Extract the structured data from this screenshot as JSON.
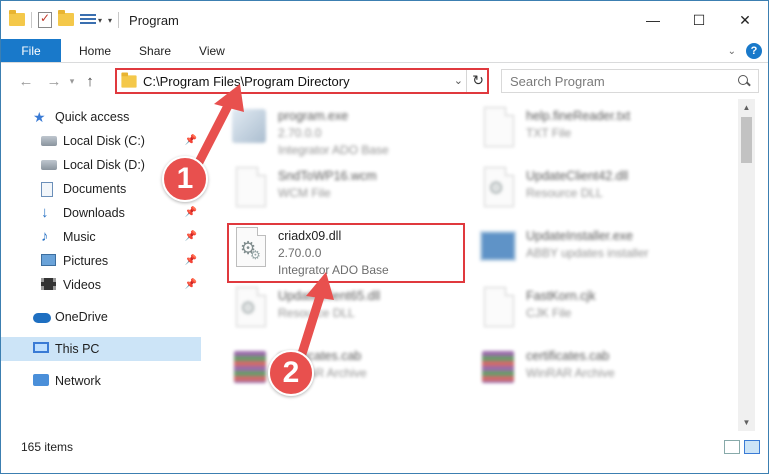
{
  "window": {
    "title": "Program",
    "controls": {
      "minimize": "—",
      "maximize": "☐",
      "close": "✕"
    }
  },
  "ribbon": {
    "tabs": [
      "File",
      "Home",
      "Share",
      "View"
    ]
  },
  "address": {
    "path": "C:\\Program Files\\Program Directory",
    "search_placeholder": "Search Program"
  },
  "sidebar": {
    "items": [
      {
        "label": "Quick access",
        "icon": "star-icon",
        "pinned": false
      },
      {
        "label": "Local Disk (C:)",
        "icon": "disk-icon",
        "pinned": true
      },
      {
        "label": "Local Disk (D:)",
        "icon": "disk-icon",
        "pinned": true
      },
      {
        "label": "Documents",
        "icon": "documents-icon",
        "pinned": true
      },
      {
        "label": "Downloads",
        "icon": "download-icon",
        "pinned": true
      },
      {
        "label": "Music",
        "icon": "music-icon",
        "pinned": true
      },
      {
        "label": "Pictures",
        "icon": "pictures-icon",
        "pinned": true
      },
      {
        "label": "Videos",
        "icon": "videos-icon",
        "pinned": true
      },
      {
        "label": "OneDrive",
        "icon": "onedrive-icon",
        "pinned": false
      },
      {
        "label": "This PC",
        "icon": "pc-icon",
        "pinned": false,
        "selected": true
      },
      {
        "label": "Network",
        "icon": "network-icon",
        "pinned": false
      }
    ]
  },
  "files": [
    {
      "name": "program.exe",
      "line2": "2.70.0.0",
      "line3": "Integrator ADO Base",
      "icon": "exe-icon",
      "blurred": true
    },
    {
      "name": "help.fineReader.txt",
      "line2": "TXT File",
      "line3": "",
      "icon": "text-file-icon",
      "blurred": true
    },
    {
      "name": "SndToWP16.wcm",
      "line2": "WCM File",
      "line3": "",
      "icon": "generic-file-icon",
      "blurred": true
    },
    {
      "name": "UpdateClient42.dll",
      "line2": "Resource DLL",
      "line3": "",
      "icon": "dll-icon",
      "blurred": true
    },
    {
      "name": "criadx09.dll",
      "line2": "2.70.0.0",
      "line3": "Integrator ADO Base",
      "icon": "dll-icon",
      "blurred": false
    },
    {
      "name": "UpdateInstaller.exe",
      "line2": "ABBY updates installer",
      "line3": "",
      "icon": "installer-icon",
      "blurred": true
    },
    {
      "name": "UpdateClient65.dll",
      "line2": "Resource DLL",
      "line3": "",
      "icon": "dll-icon",
      "blurred": true
    },
    {
      "name": "FastKorn.cjk",
      "line2": "CJK File",
      "line3": "",
      "icon": "generic-file-icon",
      "blurred": true
    },
    {
      "name": "certificates.cab",
      "line2": "WinRAR Archive",
      "line3": "",
      "icon": "winrar-icon",
      "blurred": true
    },
    {
      "name": "certificates.cab",
      "line2": "WinRAR Archive",
      "line3": "",
      "icon": "winrar-icon",
      "blurred": true
    }
  ],
  "status": {
    "item_count": "165 items"
  },
  "annotations": {
    "badge1": "1",
    "badge2": "2",
    "accent": "#e0393e"
  }
}
